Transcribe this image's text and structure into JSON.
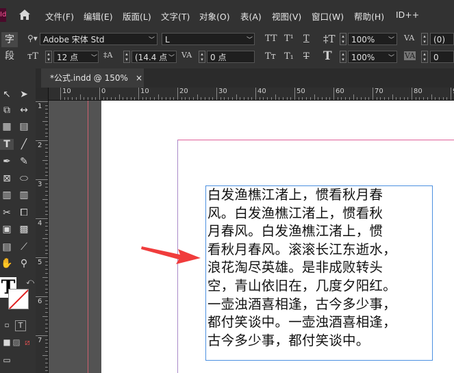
{
  "app": {
    "logo": "Id"
  },
  "menubar": {
    "home_icon": "home-icon",
    "items": [
      "文件(F)",
      "编辑(E)",
      "版面(L)",
      "文字(T)",
      "对象(O)",
      "表(A)",
      "视图(V)",
      "窗口(W)",
      "帮助(H)",
      "ID++"
    ]
  },
  "control": {
    "char_label": "字",
    "para_label": "段",
    "font_family": "Adobe 宋体 Std",
    "font_style": "L",
    "font_size": "12 点",
    "leading": "(14.4 点",
    "kerning": "0 点",
    "vscale": "100%",
    "hscale": "100%",
    "tracking": "(0)",
    "baseline": "0"
  },
  "document": {
    "tab_title": "*公式.indd @ 150%",
    "close": "×"
  },
  "rulers": {
    "horizontal": [
      "10",
      "0",
      "10",
      "20",
      "30",
      "40",
      "50",
      "60",
      "70",
      "80",
      "90",
      "10"
    ],
    "vertical": [
      "1",
      "2",
      "3",
      "4",
      "5",
      "6",
      "7"
    ]
  },
  "content": {
    "lines": [
      "白发渔樵江渚上，惯看秋月春",
      "风。白发渔樵江渚上，惯看秋",
      "月春风。白发渔樵江渚上，惯",
      "看秋月春风。滚滚长江东逝水，",
      "浪花淘尽英雄。是非成败转头",
      "空，青山依旧在，几度夕阳红。",
      "一壶浊酒喜相逢，古今多少事，",
      "都付笑谈中。一壶浊酒喜相逢，",
      "古今多少事，都付笑谈中。"
    ]
  },
  "colors": {
    "accent_arrow": "#f03c3c",
    "frame_border": "#4a8fe0",
    "margin_guide": "#e0609a"
  }
}
